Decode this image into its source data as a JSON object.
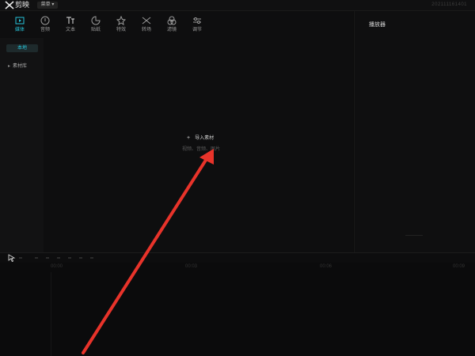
{
  "app": {
    "name": "剪映",
    "menu_label": "菜单",
    "project_id": "202111161401"
  },
  "media_tabs": [
    {
      "label": "媒体",
      "icon": "media-icon",
      "active": true
    },
    {
      "label": "音频",
      "icon": "audio-icon",
      "active": false
    },
    {
      "label": "文本",
      "icon": "text-icon",
      "active": false
    },
    {
      "label": "贴纸",
      "icon": "sticker-icon",
      "active": false
    },
    {
      "label": "特效",
      "icon": "effects-icon",
      "active": false
    },
    {
      "label": "转场",
      "icon": "transition-icon",
      "active": false
    },
    {
      "label": "滤镜",
      "icon": "filter-icon",
      "active": false
    },
    {
      "label": "调节",
      "icon": "adjust-icon",
      "active": false
    }
  ],
  "side_list": {
    "local": "本地",
    "library": "素材库"
  },
  "import": {
    "button": "导入素材",
    "hint": "视频、音频、图片"
  },
  "player": {
    "title": "播放器"
  },
  "timeline": {
    "ticks": [
      "00:00",
      "00:03",
      "00:06",
      "00:09"
    ]
  },
  "colors": {
    "accent": "#27c3d9",
    "arrow": "#e8332a"
  }
}
